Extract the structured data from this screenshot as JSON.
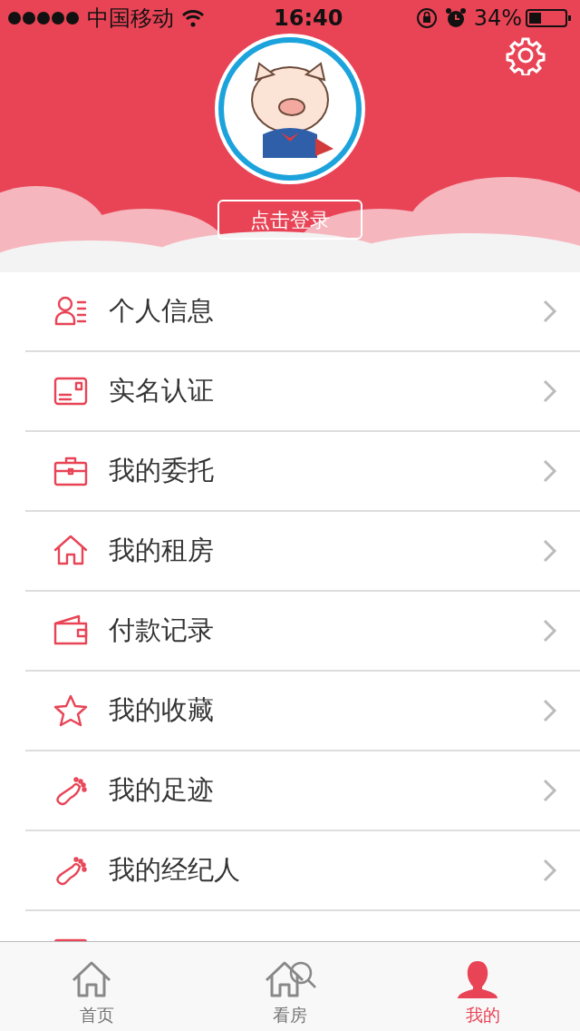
{
  "status_bar": {
    "carrier": "中国移动",
    "time": "16:40",
    "battery": "34%"
  },
  "header": {
    "login_button": "点击登录"
  },
  "menu": [
    {
      "label": "个人信息"
    },
    {
      "label": "实名认证"
    },
    {
      "label": "我的委托"
    },
    {
      "label": "我的租房"
    },
    {
      "label": "付款记录"
    },
    {
      "label": "我的收藏"
    },
    {
      "label": "我的足迹"
    },
    {
      "label": "我的经纪人"
    }
  ],
  "tab_bar": [
    {
      "label": "首页",
      "selected": false
    },
    {
      "label": "看房",
      "selected": false
    },
    {
      "label": "我的",
      "selected": true
    }
  ]
}
